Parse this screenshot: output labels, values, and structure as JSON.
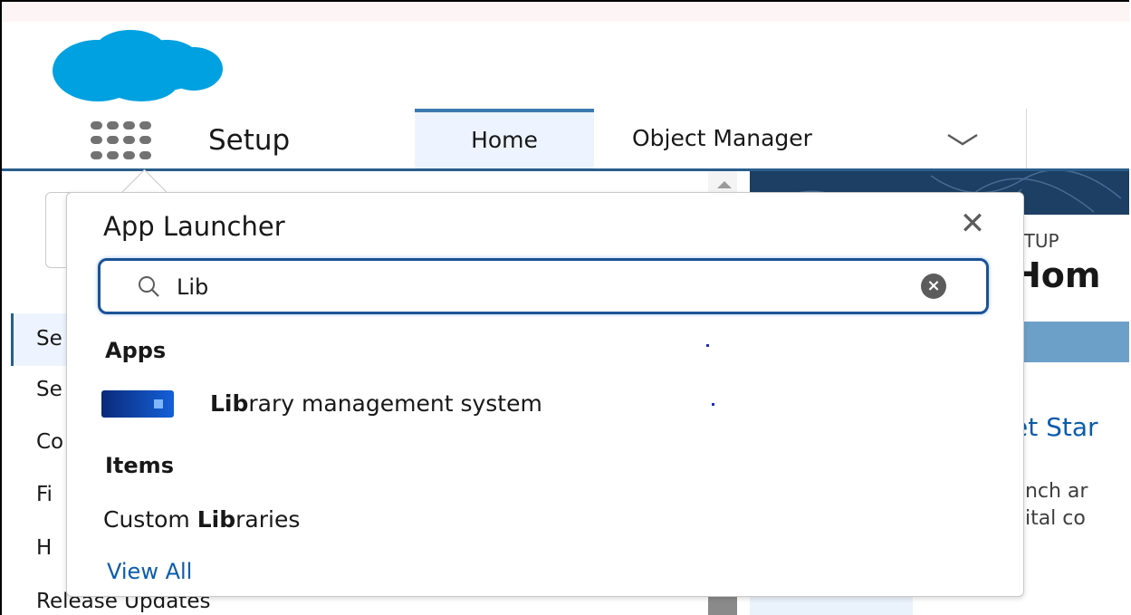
{
  "colors": {
    "brand": "#00a1e0",
    "nav_accent": "#2b5d8c",
    "link": "#0b5cab",
    "search_border": "#1b5297"
  },
  "icons": {
    "logo": "salesforce-cloud-logo",
    "app_launcher": "waffle-grid-icon",
    "dropdown": "chevron-down-icon",
    "close": "close-icon",
    "search": "search-icon",
    "clear": "clear-input-icon"
  },
  "nav": {
    "app_name": "Setup",
    "tabs": [
      {
        "label": "Home",
        "active": true
      },
      {
        "label": "Object Manager",
        "active": false
      }
    ]
  },
  "sidebar": {
    "items": [
      {
        "label": "Se"
      },
      {
        "label": "Se"
      },
      {
        "label": "Co"
      },
      {
        "label": "Fi"
      },
      {
        "label": "H"
      },
      {
        "label": "Release Updates"
      }
    ]
  },
  "content": {
    "setup_label": "ETUP",
    "heading": "Hom",
    "get_started": "et Star",
    "desc_line1": "unch ar",
    "desc_line2": "gital co"
  },
  "app_launcher": {
    "title": "App Launcher",
    "search": {
      "value": "Lib",
      "placeholder": ""
    },
    "apps_heading": "Apps",
    "apps": [
      {
        "match": "Lib",
        "rest": "rary management system"
      }
    ],
    "items_heading": "Items",
    "items": [
      {
        "prefix": "Custom ",
        "match": "Lib",
        "rest": "raries"
      }
    ],
    "view_all": "View All"
  }
}
